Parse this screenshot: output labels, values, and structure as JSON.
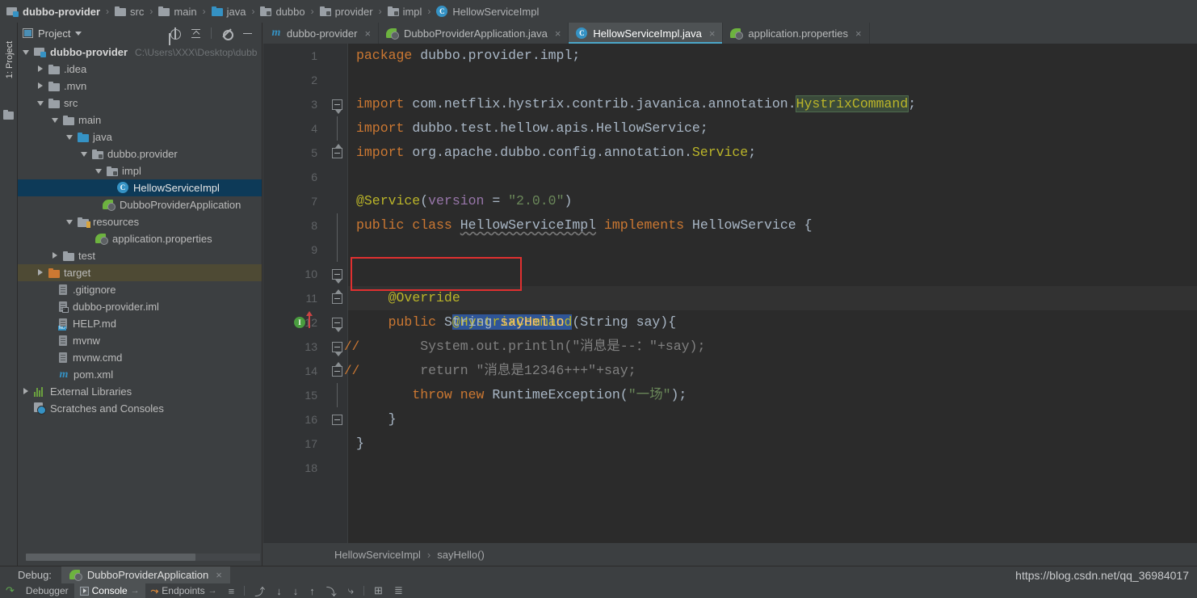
{
  "breadcrumb": {
    "items": [
      {
        "label": "dubbo-provider",
        "icon": "module-icon",
        "bold": true
      },
      {
        "label": "src",
        "icon": "folder-icon"
      },
      {
        "label": "main",
        "icon": "folder-icon"
      },
      {
        "label": "java",
        "icon": "source-folder-icon"
      },
      {
        "label": "dubbo",
        "icon": "package-icon"
      },
      {
        "label": "provider",
        "icon": "package-icon"
      },
      {
        "label": "impl",
        "icon": "package-icon"
      },
      {
        "label": "HellowServiceImpl",
        "icon": "class-icon"
      }
    ],
    "separator": "›"
  },
  "tool_strip": {
    "project_tab_label": "1: Project"
  },
  "project_panel": {
    "title": "Project",
    "dropdown_caret": "▾",
    "tools": [
      {
        "name": "locate-icon"
      },
      {
        "name": "collapse-all-icon"
      },
      {
        "name": "gear-icon"
      },
      {
        "name": "hide-icon"
      }
    ],
    "tree": [
      {
        "label": "dubbo-provider",
        "path": "C:\\Users\\XXX\\Desktop\\dubb",
        "indent": 0,
        "arrow": "open",
        "icon": "module-icon",
        "bold": true
      },
      {
        "label": ".idea",
        "indent": 1,
        "arrow": "closed",
        "icon": "folder-icon"
      },
      {
        "label": ".mvn",
        "indent": 1,
        "arrow": "closed",
        "icon": "folder-icon"
      },
      {
        "label": "src",
        "indent": 1,
        "arrow": "open",
        "icon": "folder-icon"
      },
      {
        "label": "main",
        "indent": 2,
        "arrow": "open",
        "icon": "folder-icon"
      },
      {
        "label": "java",
        "indent": 3,
        "arrow": "open",
        "icon": "source-folder-icon"
      },
      {
        "label": "dubbo.provider",
        "indent": 4,
        "arrow": "open",
        "icon": "package-icon"
      },
      {
        "label": "impl",
        "indent": 5,
        "arrow": "open",
        "icon": "package-icon"
      },
      {
        "label": "HellowServiceImpl",
        "indent": 6,
        "arrow": "none",
        "icon": "class-icon",
        "selected": true
      },
      {
        "label": "DubboProviderApplication",
        "indent": 5,
        "arrow": "none",
        "icon": "spring-class-icon"
      },
      {
        "label": "resources",
        "indent": 3,
        "arrow": "open",
        "icon": "resource-folder-icon"
      },
      {
        "label": "application.properties",
        "indent": 4,
        "arrow": "none",
        "icon": "spring-properties-icon"
      },
      {
        "label": "test",
        "indent": 2,
        "arrow": "closed",
        "icon": "folder-icon"
      },
      {
        "label": "target",
        "indent": 1,
        "arrow": "closed",
        "icon": "excluded-folder-icon",
        "highlighted": true
      },
      {
        "label": ".gitignore",
        "indent": 2,
        "arrow": "none",
        "icon": "file-icon"
      },
      {
        "label": "dubbo-provider.iml",
        "indent": 2,
        "arrow": "none",
        "icon": "iml-file-icon"
      },
      {
        "label": "HELP.md",
        "indent": 2,
        "arrow": "none",
        "icon": "markdown-file-icon"
      },
      {
        "label": "mvnw",
        "indent": 2,
        "arrow": "none",
        "icon": "file-icon"
      },
      {
        "label": "mvnw.cmd",
        "indent": 2,
        "arrow": "none",
        "icon": "file-icon"
      },
      {
        "label": "pom.xml",
        "indent": 2,
        "arrow": "none",
        "icon": "maven-file-icon"
      },
      {
        "label": "External Libraries",
        "indent": 0,
        "arrow": "closed",
        "icon": "library-icon"
      },
      {
        "label": "Scratches and Consoles",
        "indent": 0,
        "arrow": "none",
        "icon": "scratches-icon"
      }
    ]
  },
  "editor_tabs": [
    {
      "label": "dubbo-provider",
      "icon": "maven-icon",
      "active": false,
      "close": "×"
    },
    {
      "label": "DubboProviderApplication.java",
      "icon": "spring-class-icon",
      "active": false,
      "close": "×"
    },
    {
      "label": "HellowServiceImpl.java",
      "icon": "class-icon",
      "active": true,
      "close": "×"
    },
    {
      "label": "application.properties",
      "icon": "spring-properties-icon",
      "active": false,
      "close": "×"
    }
  ],
  "editor": {
    "lines": [
      {
        "n": "1",
        "fold": "none"
      },
      {
        "n": "2",
        "fold": "none"
      },
      {
        "n": "3",
        "fold": "tri-dn"
      },
      {
        "n": "4",
        "fold": "none"
      },
      {
        "n": "5",
        "fold": "tri-up"
      },
      {
        "n": "6",
        "fold": "none"
      },
      {
        "n": "7",
        "fold": "none"
      },
      {
        "n": "8",
        "fold": "none"
      },
      {
        "n": "9",
        "fold": "none"
      },
      {
        "n": "10",
        "fold": "tri-dn"
      },
      {
        "n": "11",
        "fold": "tri-up"
      },
      {
        "n": "12",
        "fold": "tri-dn",
        "badge": "I",
        "override_arrow": true
      },
      {
        "n": "13",
        "fold": "tri-dn",
        "comment_mark": "//"
      },
      {
        "n": "14",
        "fold": "tri-up",
        "comment_mark": "//"
      },
      {
        "n": "15",
        "fold": "none"
      },
      {
        "n": "16",
        "fold": "plain"
      },
      {
        "n": "17",
        "fold": "none"
      },
      {
        "n": "18",
        "fold": "none"
      }
    ],
    "code": {
      "l1_kw": "package",
      "l1_rest": " dubbo.provider.impl;",
      "l3_kw": "import",
      "l3_rest": " com.netflix.hystrix.contrib.javanica.annotation.",
      "l3_hl": "HystrixCommand",
      "l3_end": ";",
      "l4_kw": "import",
      "l4_rest": " dubbo.test.hellow.apis.HellowService;",
      "l5_kw": "import",
      "l5_rest": " org.apache.dubbo.config.annotation.",
      "l5_ann": "Service",
      "l5_end": ";",
      "l7_ann": "@Service",
      "l7_p1": "(",
      "l7_param": "version",
      "l7_eq": " = ",
      "l7_str": "\"2.0.0\"",
      "l7_p2": ")",
      "l8_kw1": "public",
      "l8_kw2": "class",
      "l8_name": "HellowServiceImpl",
      "l8_kw3": "implements",
      "l8_iface": "HellowService",
      "l8_brace": "{",
      "l10_sel": "@HystrixCommand",
      "l11_ann": "@Override",
      "l12_kw1": "public",
      "l12_type": "String",
      "l12_mth": "sayHello",
      "l12_args": " (String say)",
      "l12_brace": "{",
      "l13_pre": "        System.out.println(",
      "l13_str": "\"消息是--：\"",
      "l13_post": "+say);",
      "l14_pre": "        return ",
      "l14_str": "\"消息是12346+++\"",
      "l14_post": "+say;",
      "l15_kw1": "throw",
      "l15_kw2": "new",
      "l15_cls": "RuntimeException",
      "l15_p1": "(",
      "l15_str": "\"一场\"",
      "l15_p2": ");",
      "l16_brace": "}",
      "l17_brace": "}"
    }
  },
  "code_breadcrumb": {
    "class": "HellowServiceImpl",
    "separator": "›",
    "method": "sayHello()"
  },
  "debug_panel": {
    "label": "Debug:",
    "session": "DubboProviderApplication",
    "close": "×",
    "tools": [
      {
        "name": "rerun-icon",
        "label": ""
      },
      {
        "name": "debugger-tab",
        "label": "Debugger"
      },
      {
        "name": "console-tab",
        "label": "Console",
        "active": true
      },
      {
        "name": "endpoints-tab",
        "label": "Endpoints"
      },
      {
        "name": "frames-icon",
        "label": ""
      },
      {
        "name": "step-over-icon",
        "label": ""
      },
      {
        "name": "step-into-icon",
        "label": ""
      },
      {
        "name": "force-step-into-icon",
        "label": ""
      },
      {
        "name": "step-out-icon",
        "label": ""
      },
      {
        "name": "drop-frame-icon",
        "label": ""
      },
      {
        "name": "run-to-cursor-icon",
        "label": ""
      },
      {
        "name": "evaluate-icon",
        "label": ""
      },
      {
        "name": "layout-icon",
        "label": ""
      }
    ]
  },
  "watermark": {
    "url": "https://blog.csdn.net/qq_36984017"
  },
  "colors": {
    "accent": "#3592c4",
    "selection_tree": "#0d3a58",
    "selection_text": "#2f5597",
    "annotation_red": "#e03030",
    "keyword": "#cc7832",
    "string": "#6a8759",
    "annotation": "#bbb529",
    "comment": "#808080",
    "method": "#ffc66d",
    "editor_bg": "#2b2b2b",
    "panel_bg": "#3c3f41"
  }
}
